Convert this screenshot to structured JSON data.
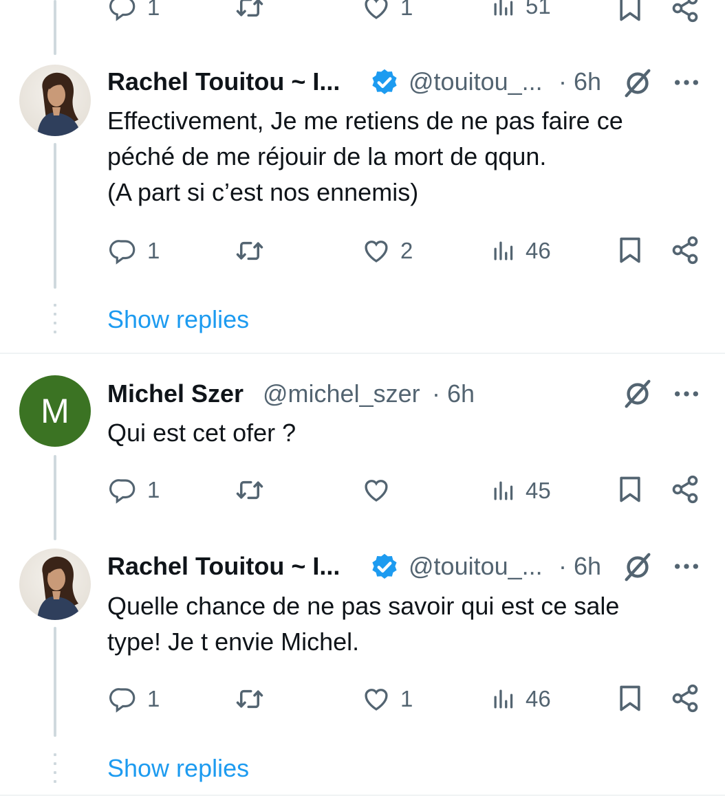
{
  "top_partial_row": {
    "reply_count": "1",
    "like_count": "1",
    "view_count": "51"
  },
  "replies": [
    {
      "author_name": "Rachel Touitou ~ I...",
      "handle": "@touitou_...",
      "time": "· 6h",
      "verified": true,
      "text": "Effectivement, Je me retiens de ne pas faire ce\npéché de me réjouir de la mort de qqun.\n(A part si c’est nos ennemis)",
      "reply_count": "1",
      "like_count": "2",
      "view_count": "46"
    },
    {
      "author_name": "Michel Szer",
      "handle": "@michel_szer",
      "time": "· 6h",
      "avatar_letter": "M",
      "text": "Qui est cet ofer ?",
      "reply_count": "1",
      "like_count": "",
      "view_count": "45"
    },
    {
      "author_name": "Rachel Touitou ~ I...",
      "handle": "@touitou_...",
      "time": "· 6h",
      "verified": true,
      "text": "Quelle chance de ne pas savoir qui est ce sale\ntype! Je t envie Michel.",
      "reply_count": "1",
      "like_count": "1",
      "view_count": "46"
    }
  ],
  "show_replies_label": "Show replies",
  "colors": {
    "text": "#0f1419",
    "secondary": "#536471",
    "link": "#1d9bf0",
    "verified": "#1d9bf0",
    "thread_line": "#cfd9de",
    "avatar_green": "#3b7323"
  },
  "icons": [
    "reply-icon",
    "retweet-icon",
    "like-icon",
    "views-icon",
    "bookmark-icon",
    "share-icon",
    "grok-icon",
    "more-icon",
    "verified-badge-icon"
  ]
}
